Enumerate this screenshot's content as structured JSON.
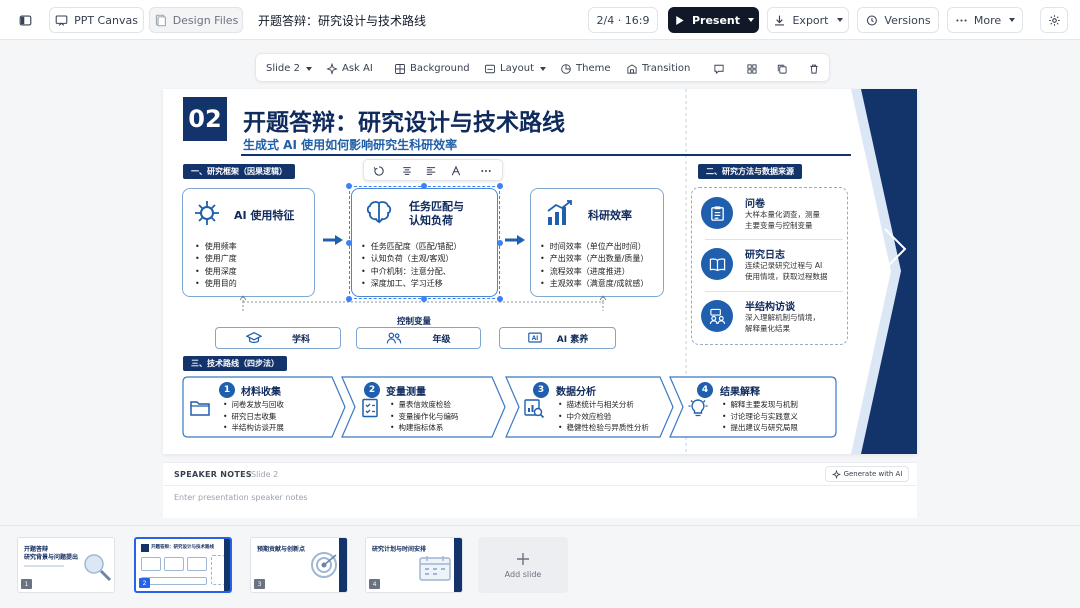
{
  "topbar": {
    "canvas_tab": "PPT Canvas",
    "design_tab": "Design Files",
    "doc_title": "开题答辩：研究设计与技术路线",
    "page_indicator": "2/4 · 16:9",
    "present": "Present",
    "export": "Export",
    "versions": "Versions",
    "more": "More"
  },
  "toolbar": {
    "slide": "Slide 2",
    "ask_ai": "Ask AI",
    "background": "Background",
    "layout": "Layout",
    "theme": "Theme",
    "transition": "Transition"
  },
  "slide": {
    "number": "02",
    "title": "开题答辩：研究设计与技术路线",
    "subtitle": "生成式 AI 使用如何影响研究生科研效率",
    "framework": {
      "heading": "一、研究框架（因果逻辑）",
      "cards": [
        {
          "title": "AI 使用特征",
          "items": [
            "使用频率",
            "使用广度",
            "使用深度",
            "使用目的"
          ]
        },
        {
          "title": "任务匹配与\n认知负荷",
          "title_line1": "任务匹配与",
          "title_line2": "认知负荷",
          "items": [
            "任务匹配度（匹配/错配）",
            "认知负荷（主观/客观）",
            "中介机制：注意分配、",
            "深度加工、学习迁移"
          ]
        },
        {
          "title": "科研效率",
          "items": [
            "时间效率（单位产出时间）",
            "产出效率（产出数量/质量）",
            "流程效率（进度推进）",
            "主观效率（满意度/成就感）"
          ]
        }
      ],
      "control_label": "控制变量",
      "controls": [
        "学科",
        "年级",
        "AI 素养"
      ]
    },
    "route": {
      "heading": "三、技术路线（四步法）",
      "steps": [
        {
          "num": "1",
          "title": "材料收集",
          "items": [
            "问卷发放与回收",
            "研究日志收集",
            "半结构访谈开展"
          ]
        },
        {
          "num": "2",
          "title": "变量测量",
          "items": [
            "量表信效度检验",
            "变量操作化与编码",
            "构建指标体系"
          ]
        },
        {
          "num": "3",
          "title": "数据分析",
          "items": [
            "描述统计与相关分析",
            "中介效应检验",
            "稳健性检验与异质性分析"
          ]
        },
        {
          "num": "4",
          "title": "结果解释",
          "items": [
            "解释主要发现与机制",
            "讨论理论与实践意义",
            "提出建议与研究局限"
          ]
        }
      ]
    },
    "methods": {
      "heading": "二、研究方法与数据来源",
      "items": [
        {
          "title": "问卷",
          "desc1": "大样本量化调查，测量",
          "desc2": "主要变量与控制变量"
        },
        {
          "title": "研究日志",
          "desc1": "连续记录研究过程与 AI",
          "desc2": "使用情境，获取过程数据"
        },
        {
          "title": "半结构访谈",
          "desc1": "深入理解机制与情境，",
          "desc2": "解释量化结果"
        }
      ]
    }
  },
  "notes": {
    "heading": "SPEAKER NOTES",
    "slide_ref": "Slide 2",
    "generate": "Generate with AI",
    "placeholder": "Enter presentation speaker notes"
  },
  "thumbnails": [
    {
      "num": "1",
      "line1": "开题答辩",
      "line2": "研究背景与问题提出"
    },
    {
      "num": "2",
      "line1": "开题答辩：研究设计与技术路线",
      "line2": ""
    },
    {
      "num": "3",
      "line1": "预期贡献与创新点",
      "line2": ""
    },
    {
      "num": "4",
      "line1": "研究计划与时间安排",
      "line2": ""
    }
  ],
  "add_slide": "Add slide",
  "colors": {
    "navy": "#13336b",
    "accent": "#1f5fae",
    "card_border": "#7fa7d3"
  }
}
